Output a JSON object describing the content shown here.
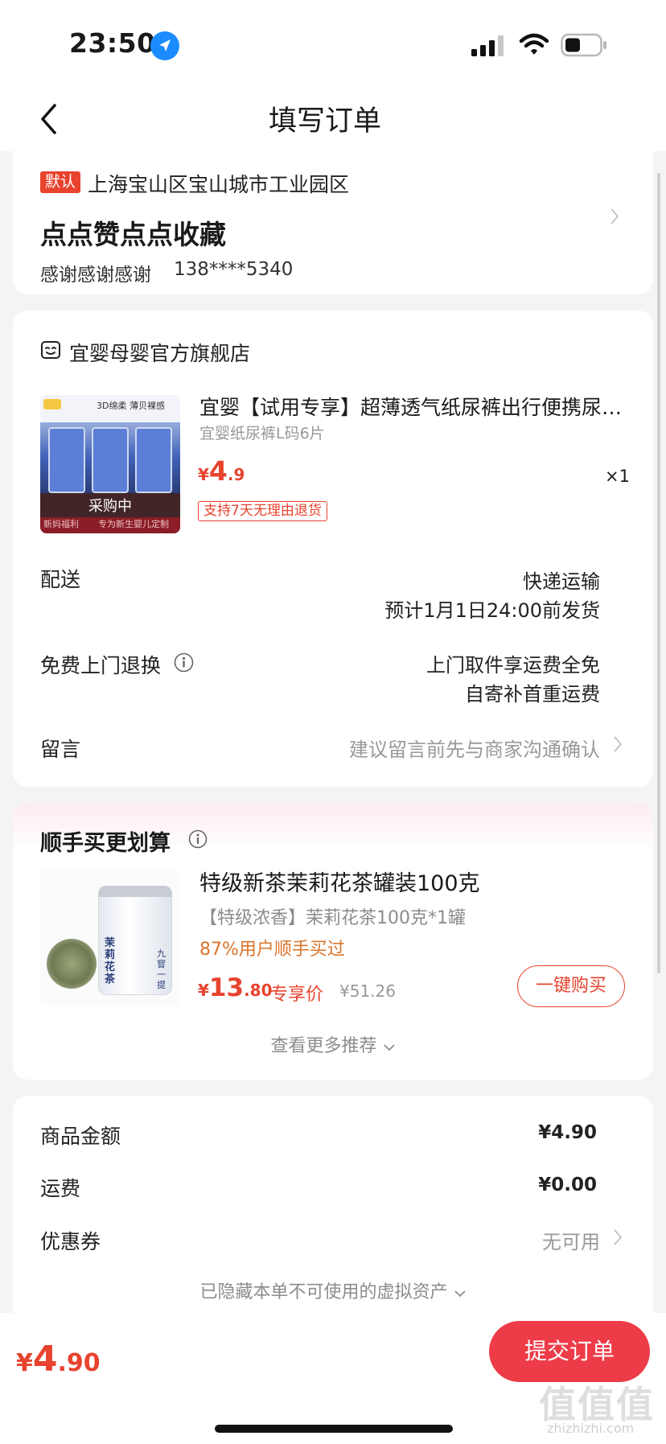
{
  "status_bar": {
    "time": "23:50"
  },
  "nav": {
    "title": "填写订单"
  },
  "address": {
    "default_tag": "默认",
    "line": "上海宝山区宝山城市工业园区",
    "name": "点点赞点点收藏",
    "contact": "感谢感谢感谢",
    "phone": "138****5340"
  },
  "shop": {
    "name": "宜婴母婴官方旗舰店"
  },
  "product": {
    "title": "宜婴【试用专享】超薄透气纸尿裤出行便携尿…",
    "spec": "宜婴纸尿裤L码6片",
    "price_currency": "¥",
    "price_int": "4",
    "price_dec": ".9",
    "qty": "×1",
    "return_tag": "支持7天无理由退货",
    "image": {
      "top_text": "3D绵柔 薄贝裸感",
      "overlay": "采购中",
      "bottom_left": "新妈福利",
      "bottom_right": "专为新生婴儿定制"
    }
  },
  "rows": {
    "delivery_label": "配送",
    "delivery_value1": "快递运输",
    "delivery_value2": "预计1月1日24:00前发货",
    "return_label": "免费上门退换",
    "return_value1": "上门取件享运费全免",
    "return_value2": "自寄补首重运费",
    "note_label": "留言",
    "note_value": "建议留言前先与商家沟通确认"
  },
  "recommend": {
    "title": "顺手买更划算",
    "name": "特级新茶茉莉花茶罐装100克",
    "desc": "【特级浓香】茉莉花茶100克*1罐",
    "sold": "87%用户顺手买过",
    "price_currency": "¥",
    "price_int": "13",
    "price_dec": ".80",
    "special": "专享价",
    "orig_price": "¥51.26",
    "buy_label": "一键购买",
    "more_label": "查看更多推荐",
    "image": {
      "can_text": "茉莉花茶",
      "side_text": "九窨一提"
    }
  },
  "summary": {
    "goods_label": "商品金额",
    "goods_value": "¥4.90",
    "freight_label": "运费",
    "freight_value": "¥0.00",
    "coupon_label": "优惠券",
    "coupon_value": "无可用",
    "hidden_label": "已隐藏本单不可使用的虚拟资产"
  },
  "bottom": {
    "total_currency": "¥",
    "total_int": "4",
    "total_dec": ".90",
    "submit_label": "提交订单"
  },
  "watermark": {
    "text": "值值值",
    "url": "zhizhizhi.com"
  },
  "colors": {
    "accent": "#e8432e",
    "submit": "#ee3b48",
    "sold": "#d9742c"
  }
}
